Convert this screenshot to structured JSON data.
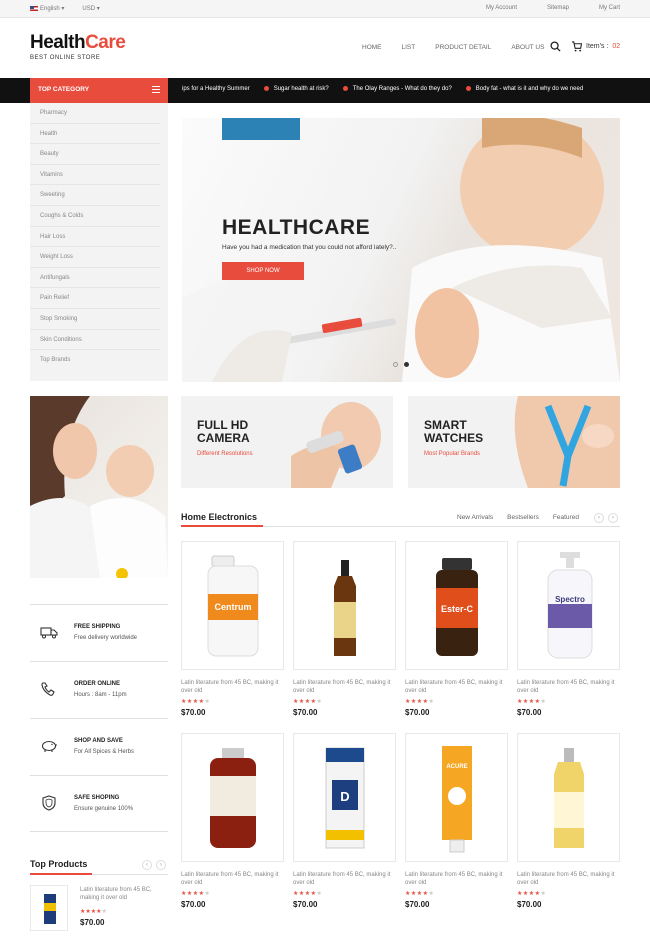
{
  "topbar": {
    "language": "English",
    "currency": "USD",
    "links": [
      "My Account",
      "Sitemap",
      "My Cart"
    ]
  },
  "logo": {
    "part1": "Health",
    "part2": "Care",
    "tagline": "BEST ONLINE STORE"
  },
  "nav": [
    "HOME",
    "LIST",
    "PRODUCT DETAIL",
    "ABOUT US"
  ],
  "cart": {
    "label": "Item's :",
    "count": "02"
  },
  "category": {
    "title": "TOP CATEGORY",
    "items": [
      "Pharmacy",
      "Health",
      "Beauty",
      "Vitamins",
      "Sweeting",
      "Coughs & Colds",
      "Hair Loss",
      "Weight Loss",
      "Antifungals",
      "Pain Relief",
      "Stop Smoking",
      "Skin Conditions",
      "Top Brands"
    ]
  },
  "ticker": [
    "ips for a Healthy Summer",
    "Sugar health at risk?",
    "The Olay Ranges - What do they do?",
    "Body fat - what is it and why do we need"
  ],
  "slider": {
    "title": "HEALTHCARE",
    "subtitle": "Have you had a medication that you could not afford lately?..",
    "button": "SHOP NOW"
  },
  "promos": [
    {
      "title1": "FULL HD",
      "title2": "CAMERA",
      "sub": "Different Resolutions"
    },
    {
      "title1": "SMART",
      "title2": "WATCHES",
      "sub": "Most Popular Brands"
    }
  ],
  "features": [
    {
      "icon": "truck-icon",
      "title": "FREE SHIPPING",
      "sub": "Free delivery worldwide"
    },
    {
      "icon": "phone-icon",
      "title": "ORDER ONLINE",
      "sub": "Hours : 8am - 11pm"
    },
    {
      "icon": "piggy-bank-icon",
      "title": "SHOP AND SAVE",
      "sub": "For All Spices & Herbs"
    },
    {
      "icon": "shield-icon",
      "title": "SAFE SHOPING",
      "sub": "Ensure genuine 100%"
    }
  ],
  "electronics": {
    "title": "Home Electronics",
    "tabs": [
      "New Arrivals",
      "Bestsellers",
      "Featured"
    ]
  },
  "product_desc": "Latin literature from 45 BC, making it over old",
  "product_price": "$70.00",
  "product_rating": 4,
  "products": [
    {
      "name": "Centrum",
      "kind": "bottle-white"
    },
    {
      "name": "",
      "kind": "dropper-amber"
    },
    {
      "name": "Ester-C",
      "kind": "bottle-dark"
    },
    {
      "name": "Spectro",
      "kind": "pump-white"
    },
    {
      "name": "",
      "kind": "bottle-red"
    },
    {
      "name": "D3",
      "kind": "box-blue"
    },
    {
      "name": "ACURE",
      "kind": "tube-orange"
    },
    {
      "name": "",
      "kind": "bottle-yellow"
    }
  ],
  "top_products": {
    "title": "Top Products"
  },
  "colors": {
    "accent": "#e84c3d",
    "dark": "#111111"
  }
}
